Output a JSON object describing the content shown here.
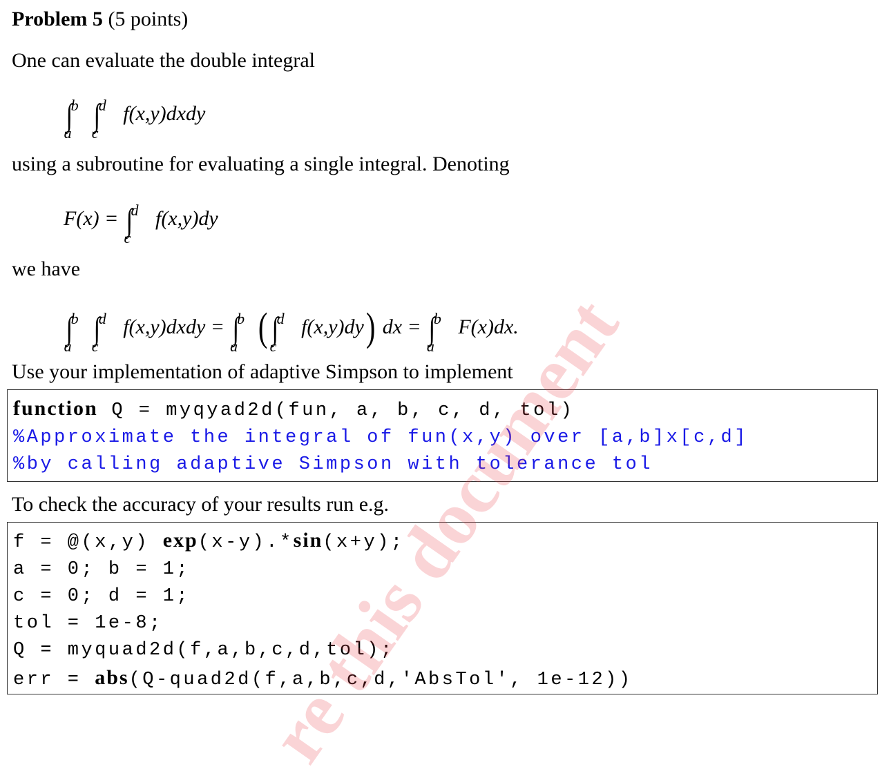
{
  "problem": {
    "title_bold": "Problem 5",
    "title_rest": " (5 points)"
  },
  "text": {
    "p1": "One can evaluate the double integral",
    "p2": "using a subroutine for evaluating a single integral. Denoting",
    "p3": "we have",
    "p4": "Use your implementation of adaptive Simpson to implement",
    "p5": "To check the accuracy of your results run e.g."
  },
  "equations": {
    "eq1": {
      "int1_lower": "a",
      "int1_upper": "b",
      "int2_lower": "c",
      "int2_upper": "d",
      "body": "f(x,y)dxdy"
    },
    "eq2": {
      "lhs": "F(x) =",
      "lower": "c",
      "upper": "d",
      "body": "f(x,y)dy"
    },
    "eq3": {
      "part1_lower1": "a",
      "part1_upper1": "b",
      "part1_lower2": "c",
      "part1_upper2": "d",
      "part1_body": "f(x,y)dxdy =",
      "part2_lower1": "a",
      "part2_upper1": "b",
      "part2_lower2": "c",
      "part2_upper2": "d",
      "part2_body": "f(x,y)dy",
      "part2_tail": "dx =",
      "part3_lower": "a",
      "part3_upper": "b",
      "part3_body": "F(x)dx."
    }
  },
  "code_block_1": {
    "line1_keyword": "function",
    "line1_rest": " Q = myqyad2d(fun, a, b, c, d, tol)",
    "line2_comment": "%Approximate the integral of fun(x,y) over [a,b]x[c,d]",
    "line3_comment": "%by calling adaptive Simpson with tolerance tol"
  },
  "code_block_2": {
    "line1_pre": "f = @(x,y) ",
    "line1_kw1": "exp",
    "line1_mid": "(x-y).*",
    "line1_kw2": "sin",
    "line1_post": "(x+y);",
    "line2": "a = 0; b = 1;",
    "line3": "c = 0; d = 1;",
    "line4": "tol = 1e-8;",
    "line5": "Q = myquad2d(f,a,b,c,d,tol);",
    "line6_pre": "err = ",
    "line6_kw": "abs",
    "line6_post": "(Q-quad2d(f,a,b,c,d,'AbsTol', 1e-12))"
  },
  "colors": {
    "comment": "#1a1ae6",
    "watermark": "#e63c46"
  },
  "watermark": {
    "text": "re this document"
  }
}
